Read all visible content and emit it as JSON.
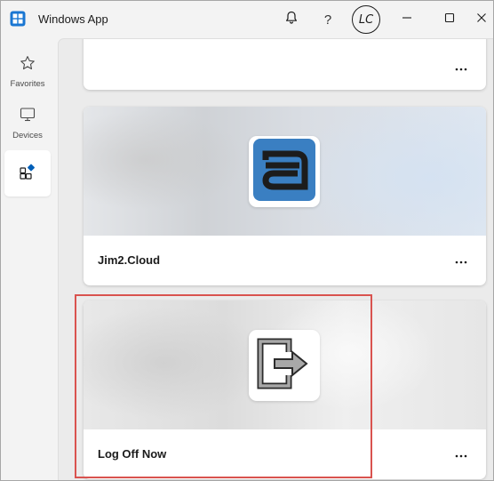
{
  "window": {
    "title": "Windows App"
  },
  "titlebar": {
    "icons": [
      "windows-app-icon",
      "bell-icon",
      "help-icon",
      "minimize-icon",
      "maximize-icon",
      "close-icon"
    ],
    "help_label": "?",
    "avatar_initials": "LC"
  },
  "sidebar": {
    "items": [
      {
        "label": "Favorites",
        "icon": "star-icon"
      },
      {
        "label": "Devices",
        "icon": "monitor-icon"
      },
      {
        "label": "",
        "icon": "apps-icon",
        "active": true
      }
    ]
  },
  "cards": [
    {
      "title": "",
      "icon": "",
      "more": "more-options-icon"
    },
    {
      "title": "Jim2.Cloud",
      "icon": "jim2-cloud-app-icon",
      "more": "more-options-icon"
    },
    {
      "title": "Log Off Now",
      "icon": "log-off-arrow-icon",
      "more": "more-options-icon"
    }
  ],
  "colors": {
    "accent": "#005fb8",
    "highlight_border": "#d9534f",
    "jim_tile_blue": "#3a7fc2"
  }
}
